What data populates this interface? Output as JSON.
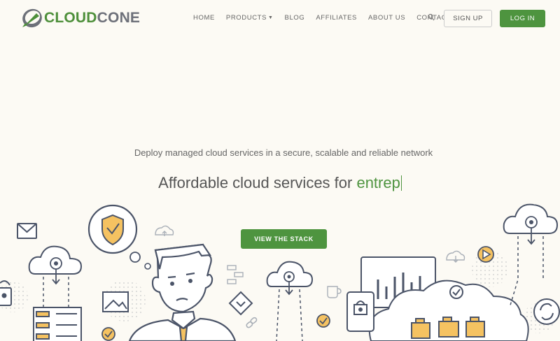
{
  "brand": {
    "name_part1": "CLOUD",
    "name_part2": "CONE",
    "accent_color": "#4e943f",
    "logo_icon": "cloudcone-logo-icon"
  },
  "nav": {
    "items": [
      {
        "label": "HOME"
      },
      {
        "label": "PRODUCTS",
        "has_dropdown": true
      },
      {
        "label": "BLOG"
      },
      {
        "label": "AFFILIATES"
      },
      {
        "label": "ABOUT US"
      },
      {
        "label": "CONTACT"
      }
    ],
    "search_icon": "search-icon",
    "signup_label": "SIGN UP",
    "login_label": "LOG IN"
  },
  "hero": {
    "subtitle": "Deploy managed cloud services in a secure, scalable and reliable network",
    "title_prefix": "Affordable cloud services for ",
    "title_typed": "entrep",
    "cta_label": "VIEW THE STACK"
  }
}
